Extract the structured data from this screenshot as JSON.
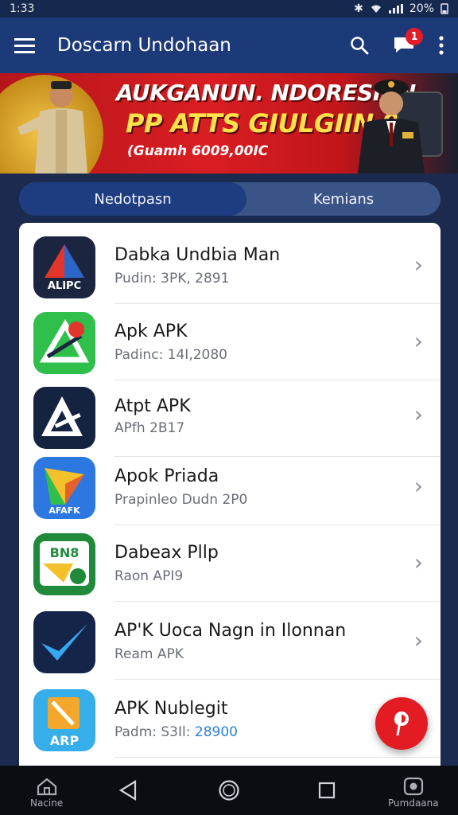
{
  "status_bar": {
    "time": "1:33",
    "battery": "20%"
  },
  "app_bar": {
    "title": "Doscarn Undohaan",
    "notification_count": "1"
  },
  "banner": {
    "headline1": "AUKGANUN. NDORESIAN",
    "headline2": "PP ATTS GIULGIIN 9K",
    "subline": "(Guamh 6009,00IC"
  },
  "tabs": [
    {
      "label": "Nedotpasn",
      "active": true
    },
    {
      "label": "Kemians",
      "active": false
    }
  ],
  "apps": [
    {
      "name": "Dabka Undbia Man",
      "meta": "Pudin: 3PK, 2891",
      "icon_text": "ALIPC"
    },
    {
      "name": "Apk APK",
      "meta": "Padinc: 14I,2080",
      "icon_text": ""
    },
    {
      "name": "Atpt APK",
      "meta": "APfh 2B17",
      "icon_text": ""
    },
    {
      "name": "Apok Priada",
      "meta": "Prapinleo Dudn 2P0",
      "icon_text": "AFAFK"
    },
    {
      "name": "Dabeax Pllp",
      "meta": "Raon API9",
      "icon_text": "BN8"
    },
    {
      "name": "AP'K Uoca Nagn in Ilonnan",
      "meta": "Ream APK",
      "icon_text": ""
    },
    {
      "name": "APK Nublegit",
      "meta_prefix": "Padm: S3Il:",
      "meta_num": "28900",
      "icon_text": "ARP"
    }
  ],
  "nav_bar": {
    "home_label": "Nacine",
    "right_label": "Pumdaana"
  },
  "colors": {
    "app_bar": "#1d3a78",
    "background": "#1b2a4e",
    "fab": "#e31b23",
    "accent_link": "#2b7fd8"
  }
}
